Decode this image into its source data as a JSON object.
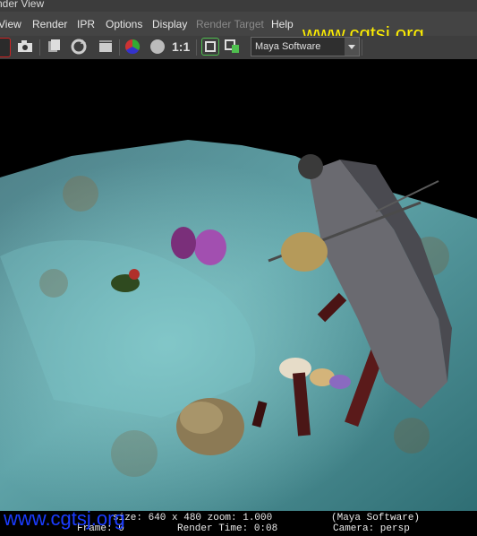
{
  "window": {
    "title": "nder View"
  },
  "menu": {
    "items": [
      {
        "label": "View",
        "enabled": true
      },
      {
        "label": "Render",
        "enabled": true
      },
      {
        "label": "IPR",
        "enabled": true
      },
      {
        "label": "Options",
        "enabled": true
      },
      {
        "label": "Display",
        "enabled": true
      },
      {
        "label": "Render Target",
        "enabled": false
      },
      {
        "label": "Help",
        "enabled": true
      }
    ]
  },
  "watermark": {
    "top": "www.cgtsj.org",
    "bottom": "www.cgtsj.org"
  },
  "toolbar": {
    "icons": [
      "render-region-icon",
      "snapshot-icon",
      "ipr-icon",
      "refresh-icon",
      "render-sequence-icon",
      "rgb-channel-icon",
      "alpha-channel-icon"
    ],
    "ratio_label": "1:1",
    "renderer": {
      "selected": "Maya Software"
    }
  },
  "status": {
    "line1_left": "size: 640 x 480  zoom: 1.000",
    "line1_right": "(Maya Software)",
    "line2_left": "Frame: 0",
    "line2_mid": "Render Time: 0:08",
    "line2_right": "Camera: persp"
  }
}
